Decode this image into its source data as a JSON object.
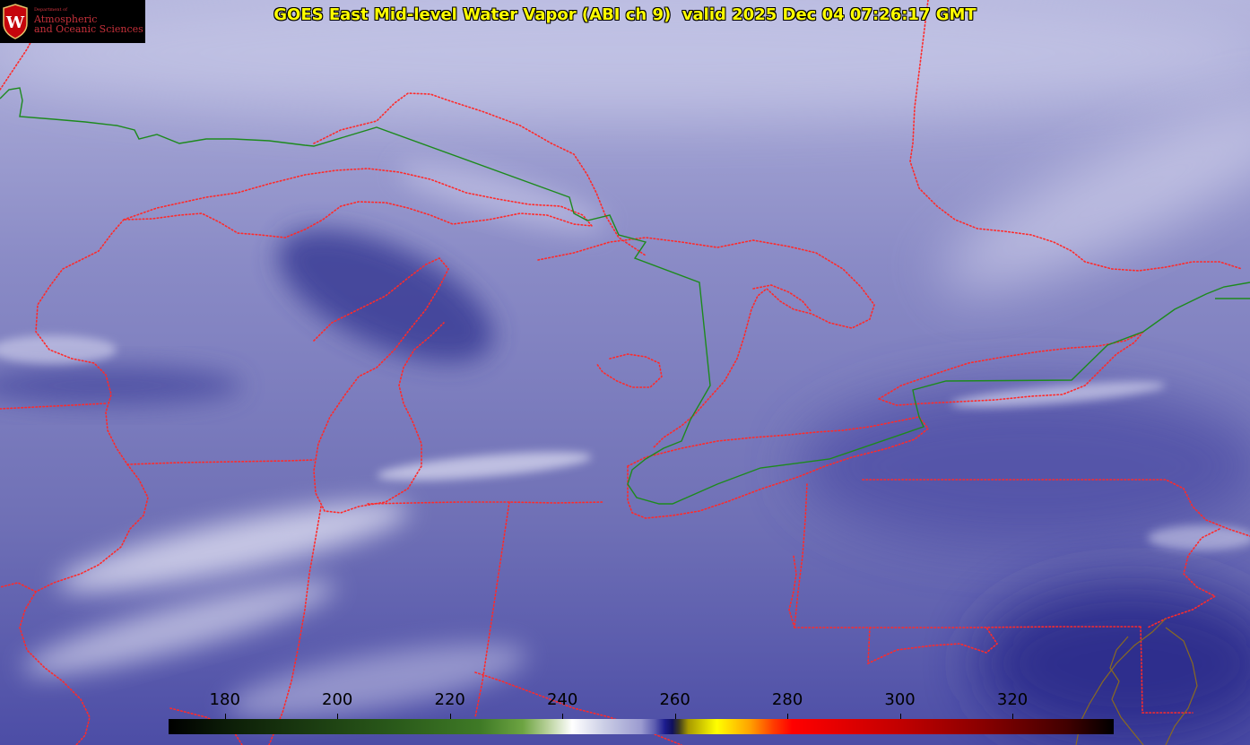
{
  "title": "GOES East Mid-level Water Vapor (ABI ch 9)  valid 2025 Dec 04 07:26:17 GMT",
  "logo": {
    "small": "Department of",
    "line1": "Atmospheric",
    "line2": "and Oceanic Sciences",
    "crest_letter": "W"
  },
  "colorbar": {
    "min": 170,
    "max": 338,
    "ticks": [
      "180",
      "200",
      "220",
      "240",
      "260",
      "280",
      "300",
      "320"
    ]
  },
  "colors": {
    "state_borders": "#ff2a2a",
    "international_border": "#1d8a1d",
    "title_text": "#ffff00",
    "vapor_dark": "#3c3d98",
    "vapor_light": "#dcdcf0"
  }
}
